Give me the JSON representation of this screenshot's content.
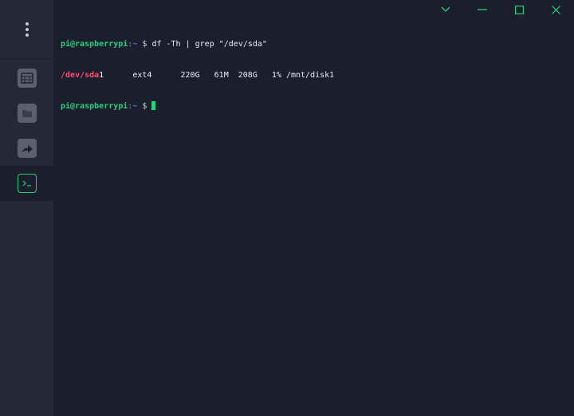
{
  "window": {
    "controls": [
      "chevron-down",
      "minimize",
      "maximize",
      "close"
    ],
    "accent_color": "#26d07c"
  },
  "sidebar": {
    "items": [
      {
        "name": "remote-desktop",
        "icon": "monitor-grid-icon",
        "active": false
      },
      {
        "name": "files",
        "icon": "folder-icon",
        "active": false
      },
      {
        "name": "port-forwarding",
        "icon": "forward-arrow-icon",
        "active": false
      },
      {
        "name": "terminal",
        "icon": "terminal-icon",
        "active": true
      }
    ]
  },
  "terminal": {
    "prompt_user": "pi@raspberrypi",
    "prompt_sep": ":",
    "prompt_path": "~",
    "prompt_symbol": "$",
    "lines": [
      {
        "type": "command",
        "command": "df -Th | grep \"/dev/sda\""
      },
      {
        "type": "output",
        "match": "/dev/sda",
        "rest": "1      ext4      220G   61M  208G   1% /mnt/disk1"
      },
      {
        "type": "command",
        "command": ""
      }
    ]
  }
}
